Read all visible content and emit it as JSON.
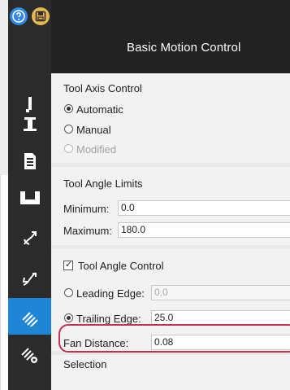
{
  "window": {
    "title": "Basic Motion Control"
  },
  "toolbar": {
    "icons": [
      "help-icon",
      "save-icon",
      "export-icon"
    ]
  },
  "sidebar": {
    "items": [
      {
        "name": "tool-axis-icon",
        "active": false
      },
      {
        "name": "tool-holder-icon",
        "active": false
      },
      {
        "name": "document-icon",
        "active": false
      },
      {
        "name": "bucket-icon",
        "active": false
      },
      {
        "name": "curve-arrow-icon",
        "active": false
      },
      {
        "name": "reverse-curve-arrow-icon",
        "active": false
      },
      {
        "name": "lines-fan-icon",
        "active": true
      },
      {
        "name": "lines-gear-icon",
        "active": false
      }
    ]
  },
  "sections": {
    "tool_axis": {
      "title": "Tool Axis Control",
      "options": [
        "Automatic",
        "Manual",
        "Modified"
      ],
      "selected": "Automatic"
    },
    "tool_angle_limits": {
      "title": "Tool Angle Limits",
      "min_label": "Minimum:",
      "min_value": "0.0",
      "max_label": "Maximum:",
      "max_value": "180.0"
    },
    "tool_angle_control": {
      "checkbox_label": "Tool Angle Control",
      "checked": true,
      "leading_label": "Leading Edge:",
      "leading_value": "0.0",
      "trailing_label": "Trailing Edge:",
      "trailing_value": "25.0",
      "selected": "Trailing Edge",
      "fan_label": "Fan Distance:",
      "fan_value": "0.08"
    },
    "selection": {
      "title": "Selection"
    }
  },
  "colors": {
    "accent": "#1f86d6",
    "highlight": "#c72f52",
    "dark": "#222222"
  }
}
